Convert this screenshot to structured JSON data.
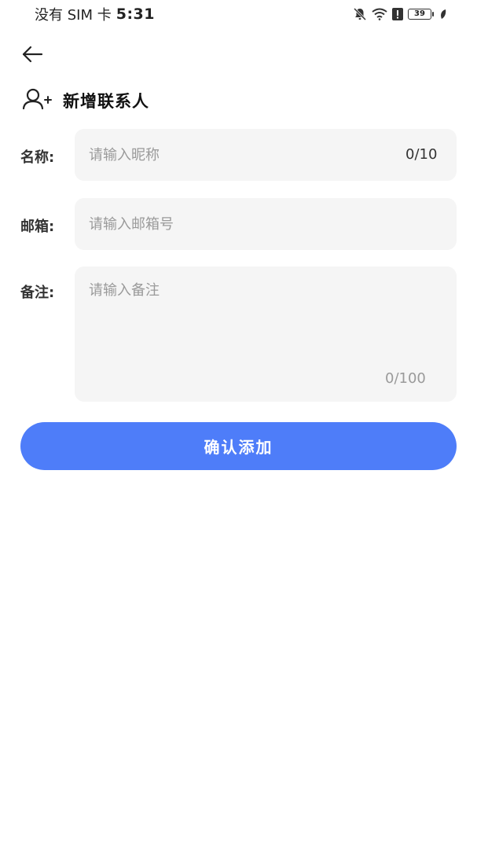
{
  "status_bar": {
    "carrier": "没有 SIM 卡",
    "time": "5:31",
    "battery": "39"
  },
  "header": {
    "title": "新增联系人"
  },
  "form": {
    "name": {
      "label": "名称:",
      "placeholder": "请输入昵称",
      "value": "",
      "counter": "0/10"
    },
    "email": {
      "label": "邮箱:",
      "placeholder": "请输入邮箱号",
      "value": ""
    },
    "note": {
      "label": "备注:",
      "placeholder": "请输入备注",
      "value": "",
      "counter": "0/100"
    }
  },
  "submit": {
    "label": "确认添加"
  },
  "colors": {
    "accent": "#4e7df9",
    "field_bg": "#f5f5f5",
    "placeholder": "#9a9a9a"
  },
  "icons": {
    "back": "arrow-left-icon",
    "header": "add-user-icon",
    "status": [
      "bell-off-icon",
      "wifi-icon",
      "alert-icon",
      "battery-icon",
      "leaf-icon"
    ]
  }
}
